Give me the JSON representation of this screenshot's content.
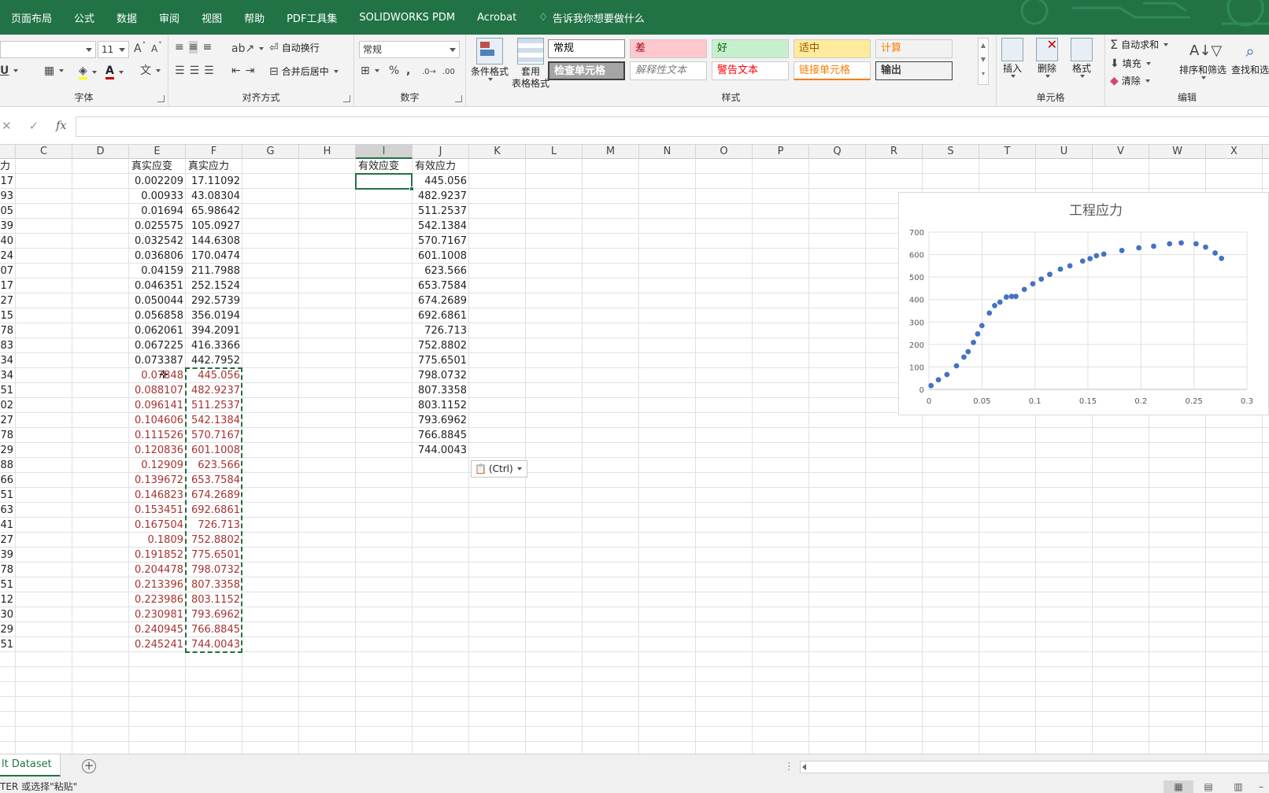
{
  "menu": {
    "tabs": [
      "页面布局",
      "公式",
      "数据",
      "审阅",
      "视图",
      "帮助",
      "PDF工具集",
      "SOLIDWORKS PDM",
      "Acrobat"
    ],
    "tell_me": "告诉我你想要做什么"
  },
  "ribbon": {
    "font": {
      "size": "11",
      "label": "字体",
      "grow": "A",
      "shrink": "A",
      "underline": "U",
      "font_color_glyph": "A"
    },
    "alignment": {
      "label": "对齐方式",
      "wrap_text": "自动换行",
      "merge_center": "合并后居中"
    },
    "number": {
      "label": "数字",
      "format": "常规",
      "percent": "%",
      "comma": ","
    },
    "styles": {
      "label": "样式",
      "conditional": "条件格式",
      "table_line1": "套用",
      "table_line2": "表格格式",
      "gallery": [
        {
          "text": "常规",
          "bg": "#ffffff",
          "fg": "#000000"
        },
        {
          "text": "差",
          "bg": "#ffc7ce",
          "fg": "#9c0006"
        },
        {
          "text": "好",
          "bg": "#c6efce",
          "fg": "#006100"
        },
        {
          "text": "适中",
          "bg": "#ffeb9c",
          "fg": "#9c5700"
        },
        {
          "text": "计算",
          "bg": "#f2f2f2",
          "fg": "#fa7d00"
        },
        {
          "text": "检查单元格",
          "bg": "#a5a5a5",
          "fg": "#ffffff"
        },
        {
          "text": "解释性文本",
          "bg": "#ffffff",
          "fg": "#7f7f7f"
        },
        {
          "text": "警告文本",
          "bg": "#ffffff",
          "fg": "#ff0000"
        },
        {
          "text": "链接单元格",
          "bg": "#ffffff",
          "fg": "#fa7d00"
        },
        {
          "text": "输出",
          "bg": "#f2f2f2",
          "fg": "#3f3f3f"
        }
      ]
    },
    "cells": {
      "label": "单元格",
      "insert": "插入",
      "delete": "删除",
      "format": "格式"
    },
    "editing": {
      "label": "编辑",
      "autosum": "自动求和",
      "fill": "填充",
      "clear": "清除",
      "sort_filter": "排序和筛选",
      "find_select": "查找和选"
    }
  },
  "formula_bar": {
    "fx": "fx",
    "content": ""
  },
  "columns": [
    "C",
    "D",
    "E",
    "F",
    "G",
    "H",
    "I",
    "J",
    "K",
    "L",
    "M",
    "N",
    "O",
    "P",
    "Q",
    "R",
    "S",
    "T",
    "U",
    "V",
    "W",
    "X"
  ],
  "selected_column": "I",
  "grid": {
    "b_header": "力",
    "b_values": [
      "17",
      "93",
      "05",
      "39",
      "40",
      "24",
      "07",
      "17",
      "27",
      "15",
      "78",
      "83",
      "34",
      "34",
      "51",
      "02",
      "27",
      "78",
      "29",
      "88",
      "66",
      "51",
      "63",
      "41",
      "27",
      "39",
      "78",
      "51",
      "12",
      "30",
      "29",
      "51"
    ],
    "e_header": "真实应变",
    "f_header": "真实应力",
    "e_values": [
      "0.002209",
      "0.00933",
      "0.01694",
      "0.025575",
      "0.032542",
      "0.036806",
      "0.04159",
      "0.046351",
      "0.050044",
      "0.056858",
      "0.062061",
      "0.067225",
      "0.073387",
      "0.07848",
      "0.088107",
      "0.096141",
      "0.104606",
      "0.111526",
      "0.120836",
      "0.12909",
      "0.139672",
      "0.146823",
      "0.153451",
      "0.167504",
      "0.1809",
      "0.191852",
      "0.204478",
      "0.213396",
      "0.223986",
      "0.230981",
      "0.240945",
      "0.245241"
    ],
    "f_values": [
      "17.11092",
      "43.08304",
      "65.98642",
      "105.0927",
      "144.6308",
      "170.0474",
      "211.7988",
      "252.1524",
      "292.5739",
      "356.0194",
      "394.2091",
      "416.3366",
      "442.7952",
      "445.056",
      "482.9237",
      "511.2537",
      "542.1384",
      "570.7167",
      "601.1008",
      "623.566",
      "653.7584",
      "674.2689",
      "692.6861",
      "726.713",
      "752.8802",
      "775.6501",
      "798.0732",
      "807.3358",
      "803.1152",
      "793.6962",
      "766.8845",
      "744.0043"
    ],
    "i_header": "有效应变",
    "j_header": "有效应力",
    "j_values": [
      "445.056",
      "482.9237",
      "511.2537",
      "542.1384",
      "570.7167",
      "601.1008",
      "623.566",
      "653.7584",
      "674.2689",
      "692.6861",
      "726.713",
      "752.8802",
      "775.6501",
      "798.0732",
      "807.3358",
      "803.1152",
      "793.6962",
      "766.8845",
      "744.0043"
    ],
    "red_start_row": 13
  },
  "paste_options": "(Ctrl)",
  "chart_data": {
    "type": "scatter",
    "title": "工程应力",
    "xlim": [
      0,
      0.3
    ],
    "ylim": [
      0,
      700
    ],
    "x_ticks": [
      "0",
      "0.05",
      "0.1",
      "0.15",
      "0.2",
      "0.25",
      "0.3"
    ],
    "y_ticks": [
      "0",
      "100",
      "200",
      "300",
      "400",
      "500",
      "600",
      "700"
    ],
    "grid": true,
    "color": "#4472c4",
    "x": [
      0.002,
      0.009,
      0.017,
      0.026,
      0.033,
      0.037,
      0.042,
      0.046,
      0.05,
      0.057,
      0.062,
      0.067,
      0.073,
      0.078,
      0.082,
      0.09,
      0.098,
      0.106,
      0.114,
      0.124,
      0.133,
      0.145,
      0.152,
      0.158,
      0.165,
      0.182,
      0.198,
      0.212,
      0.227,
      0.238,
      0.252,
      0.261,
      0.27,
      0.276
    ],
    "y": [
      17,
      43,
      66,
      105,
      144,
      168,
      209,
      247,
      284,
      340,
      373,
      388,
      411,
      414,
      414,
      445,
      470,
      491,
      512,
      535,
      550,
      571,
      582,
      595,
      602,
      618,
      630,
      637,
      648,
      652,
      648,
      633,
      607,
      583
    ]
  },
  "sheet_tab": "lt Dataset",
  "status": {
    "message": "TER 或选择\"粘贴\""
  }
}
